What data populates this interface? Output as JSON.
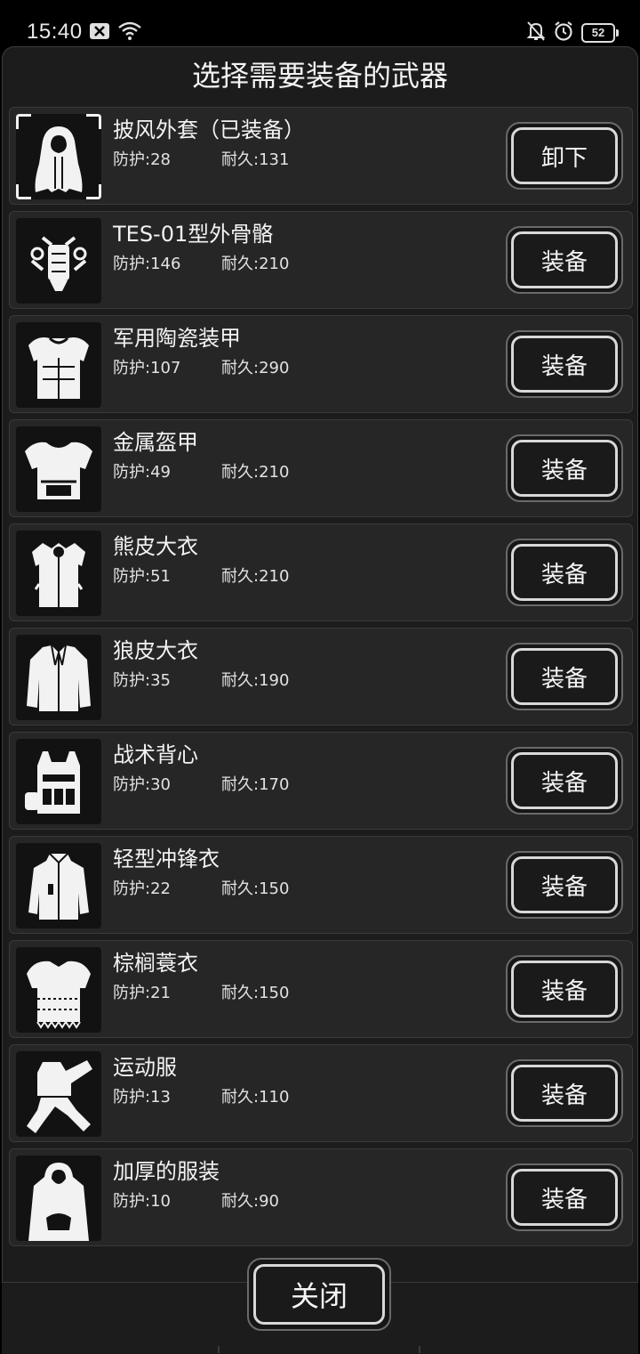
{
  "status_bar": {
    "time": "15:40",
    "battery": "52",
    "icons_left": [
      "close-box-icon",
      "wifi-icon"
    ],
    "icons_right": [
      "bell-off-icon",
      "alarm-icon",
      "battery-icon"
    ]
  },
  "dialog": {
    "title": "选择需要装备的武器",
    "close_label": "关闭"
  },
  "stat_labels": {
    "defense": "防护",
    "durability": "耐久"
  },
  "items": [
    {
      "name": "披风外套（已装备）",
      "defense": "防护:28",
      "durability": "耐久:131",
      "action": "卸下",
      "equipped": true,
      "icon": "cloak-icon"
    },
    {
      "name": "TES-01型外骨骼",
      "defense": "防护:146",
      "durability": "耐久:210",
      "action": "装备",
      "equipped": false,
      "icon": "exoskeleton-icon"
    },
    {
      "name": "军用陶瓷装甲",
      "defense": "防护:107",
      "durability": "耐久:290",
      "action": "装备",
      "equipped": false,
      "icon": "ceramic-armor-icon"
    },
    {
      "name": "金属盔甲",
      "defense": "防护:49",
      "durability": "耐久:210",
      "action": "装备",
      "equipped": false,
      "icon": "metal-armor-icon"
    },
    {
      "name": "熊皮大衣",
      "defense": "防护:51",
      "durability": "耐久:210",
      "action": "装备",
      "equipped": false,
      "icon": "bear-fur-coat-icon"
    },
    {
      "name": "狼皮大衣",
      "defense": "防护:35",
      "durability": "耐久:190",
      "action": "装备",
      "equipped": false,
      "icon": "wolf-fur-coat-icon"
    },
    {
      "name": "战术背心",
      "defense": "防护:30",
      "durability": "耐久:170",
      "action": "装备",
      "equipped": false,
      "icon": "tactical-vest-icon"
    },
    {
      "name": "轻型冲锋衣",
      "defense": "防护:22",
      "durability": "耐久:150",
      "action": "装备",
      "equipped": false,
      "icon": "light-jacket-icon"
    },
    {
      "name": "棕榈蓑衣",
      "defense": "防护:21",
      "durability": "耐久:150",
      "action": "装备",
      "equipped": false,
      "icon": "palm-raincoat-icon"
    },
    {
      "name": "运动服",
      "defense": "防护:13",
      "durability": "耐久:110",
      "action": "装备",
      "equipped": false,
      "icon": "tracksuit-icon"
    },
    {
      "name": "加厚的服装",
      "defense": "防护:10",
      "durability": "耐久:90",
      "action": "装备",
      "equipped": false,
      "icon": "hoodie-icon"
    }
  ],
  "colors": {
    "background": "#1c1c1c",
    "row": "#262626",
    "text": "#f3f3f3",
    "button_border": "#d8d8d8"
  }
}
